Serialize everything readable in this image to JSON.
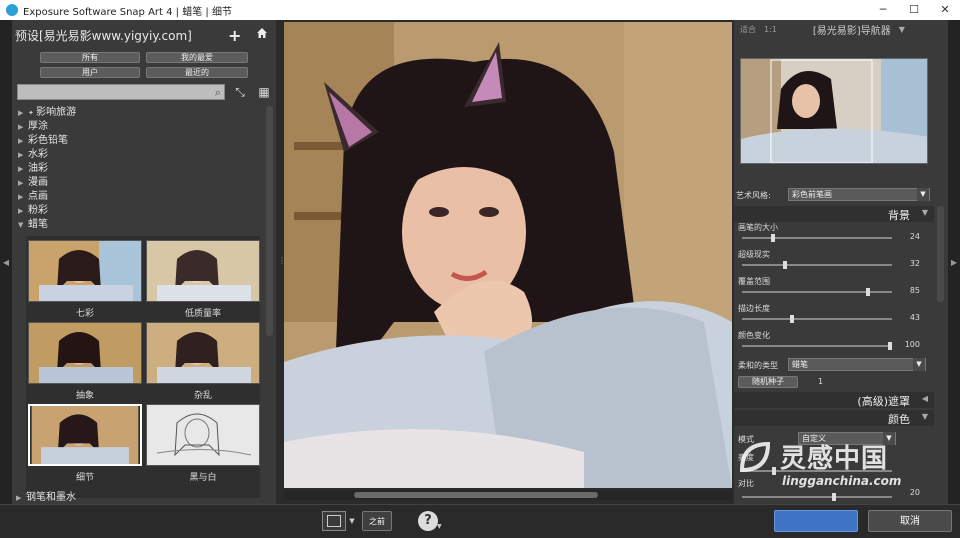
{
  "window": {
    "title": "Exposure Software Snap Art 4 | 蜡笔 | 细节",
    "controls": {
      "minimize": "─",
      "maximize": "☐",
      "close": "✕"
    }
  },
  "left": {
    "header": "预设[易光易影www.yigyiy.com]",
    "tabs": [
      "所有",
      "我的最爱",
      "用户",
      "最近的"
    ],
    "search_placeholder": "",
    "categories": [
      "影响旅游",
      "厚涂",
      "彩色铅笔",
      "水彩",
      "油彩",
      "漫画",
      "点画",
      "粉彩",
      "蜡笔"
    ],
    "thumbnails": [
      "七彩",
      "低质量率",
      "抽象",
      "杂乱",
      "细节",
      "黑与白"
    ],
    "bottom_category": "钢笔和墨水"
  },
  "right": {
    "fit_label": "适合",
    "ratio_label": "1:1",
    "navigator_title": "[易光易影]导航器",
    "art_style_label": "艺术风格:",
    "art_style_value": "彩色前笔画",
    "section_background": "背景",
    "sliders": [
      {
        "label": "画笔的大小",
        "value": 24,
        "pct": 0.2
      },
      {
        "label": "超级现实",
        "value": 32,
        "pct": 0.28
      },
      {
        "label": "覆盖范围",
        "value": 85,
        "pct": 0.85
      },
      {
        "label": "描边长度",
        "value": 43,
        "pct": 0.33
      },
      {
        "label": "颜色变化",
        "value": 100,
        "pct": 1.0
      }
    ],
    "soft_type_label": "柔和的类型",
    "soft_type_value": "蜡笔",
    "random_seed_label": "随机种子",
    "random_seed_value": "1",
    "section_mask": "(高级)遮罩",
    "section_color": "颜色",
    "color_mode_label": "模式",
    "color_mode_value": "自定义",
    "color_rows": [
      {
        "label": "亮度",
        "value": ""
      },
      {
        "label": "对比",
        "value": "20"
      }
    ]
  },
  "footer": {
    "before_label": "之前",
    "help": "?",
    "ok_label": "",
    "cancel_label": "取消"
  },
  "watermark": {
    "brand_cn": "灵感中国",
    "brand_url": "lingganchina.com"
  },
  "colors": {
    "ok_button": "#3f73c4",
    "panel": "#3a3a3a",
    "accent": "#2a9fd8"
  }
}
